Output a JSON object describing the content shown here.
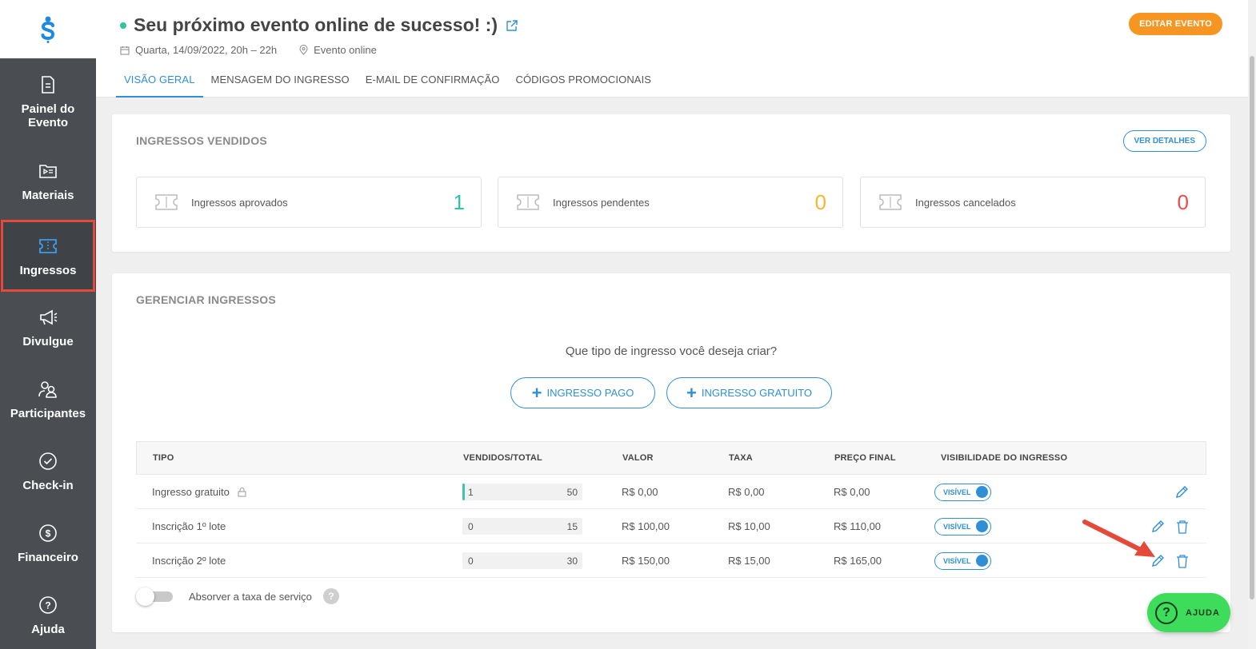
{
  "sidebar": {
    "items": [
      {
        "label": "Painel do\nEvento",
        "icon": "document-icon"
      },
      {
        "label": "Materiais",
        "icon": "folder-play-icon"
      },
      {
        "label": "Ingressos",
        "icon": "ticket-icon",
        "active": true
      },
      {
        "label": "Divulgue",
        "icon": "megaphone-icon"
      },
      {
        "label": "Participantes",
        "icon": "users-icon"
      },
      {
        "label": "Check-in",
        "icon": "check-circle-icon"
      },
      {
        "label": "Financeiro",
        "icon": "money-icon"
      },
      {
        "label": "Ajuda",
        "icon": "help-icon"
      }
    ]
  },
  "header": {
    "title": "Seu próximo evento online de sucesso! :)",
    "date": "Quarta, 14/09/2022, 20h – 22h",
    "location": "Evento online",
    "edit_label": "EDITAR EVENTO",
    "tabs": [
      "VISÃO GERAL",
      "MENSAGEM DO INGRESSO",
      "E-MAIL DE CONFIRMAÇÃO",
      "CÓDIGOS PROMOCIONAIS"
    ]
  },
  "sold": {
    "title": "INGRESSOS VENDIDOS",
    "details_label": "VER DETALHES",
    "stats": [
      {
        "label": "Ingressos aprovados",
        "value": "1",
        "color": "#2ec4a6"
      },
      {
        "label": "Ingressos pendentes",
        "value": "0",
        "color": "#f7b731"
      },
      {
        "label": "Ingressos cancelados",
        "value": "0",
        "color": "#ef4b4b"
      }
    ]
  },
  "manage": {
    "title": "GERENCIAR INGRESSOS",
    "question": "Que tipo de ingresso você deseja criar?",
    "paid_label": "INGRESSO PAGO",
    "free_label": "INGRESSO GRATUITO",
    "columns": [
      "TIPO",
      "VENDIDOS/TOTAL",
      "VALOR",
      "TAXA",
      "PREÇO FINAL",
      "VISIBILIDADE DO INGRESSO"
    ],
    "rows": [
      {
        "tipo": "Ingresso gratuito",
        "vendidos": "1",
        "total": "50",
        "sold_fraction": 0.02,
        "valor": "R$ 0,00",
        "taxa": "R$ 0,00",
        "preco": "R$ 0,00",
        "visibilidade": "VISÍVEL"
      },
      {
        "tipo": "Inscrição 1º lote",
        "vendidos": "0",
        "total": "15",
        "sold_fraction": 0,
        "valor": "R$ 100,00",
        "taxa": "R$ 10,00",
        "preco": "R$ 110,00",
        "visibilidade": "VISÍVEL"
      },
      {
        "tipo": "Inscrição 2º lote",
        "vendidos": "0",
        "total": "30",
        "sold_fraction": 0,
        "valor": "R$ 150,00",
        "taxa": "R$ 15,00",
        "preco": "R$ 165,00",
        "visibilidade": "VISÍVEL"
      }
    ],
    "absorb_label": "Absorver a taxa de serviço",
    "absorb_on": false
  },
  "help_button": {
    "label": "AJUDA"
  },
  "colors": {
    "accent": "#2f8fd6",
    "teal": "#2ec4a6",
    "orange": "#f79523",
    "sidebar": "#4a4d52",
    "highlight": "#e5493a"
  }
}
